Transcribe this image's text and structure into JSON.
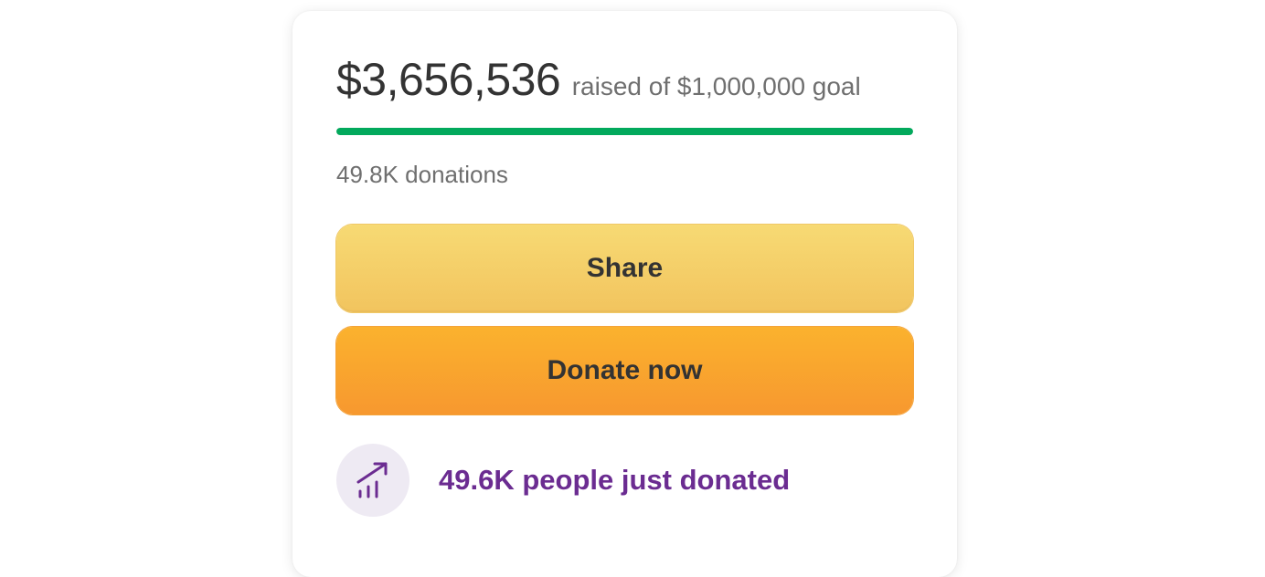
{
  "fundraiser": {
    "amount_raised": "$3,656,536",
    "goal_text": "raised of $1,000,000 goal",
    "progress_percent": 100,
    "donations_count": "49.8K donations"
  },
  "buttons": {
    "share_label": "Share",
    "donate_label": "Donate now"
  },
  "activity": {
    "icon": "trending-up-icon",
    "text": "49.6K people just donated"
  },
  "colors": {
    "progress": "#02a95c",
    "share_button": "#f5d06a",
    "donate_button": "#f9a52f",
    "activity_text": "#6b2c91",
    "activity_icon_bg": "#eeeaf3"
  }
}
